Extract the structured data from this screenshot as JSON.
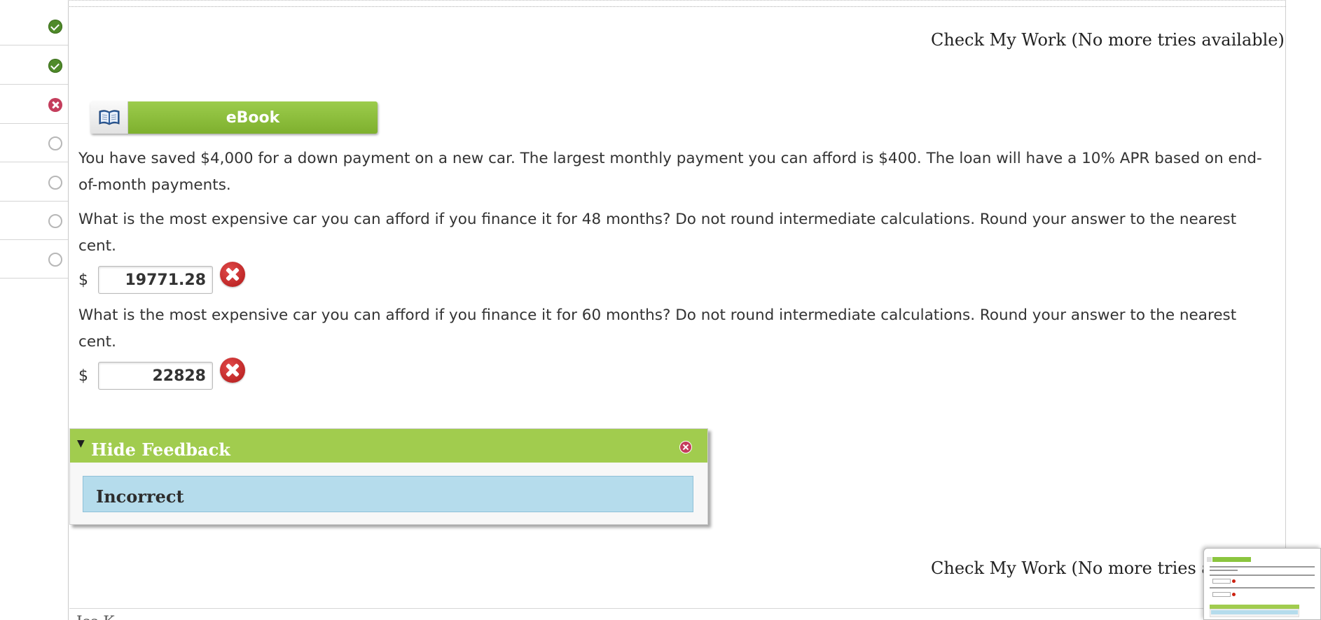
{
  "sidebar": {
    "items": [
      {
        "status": "correct"
      },
      {
        "status": "correct"
      },
      {
        "status": "incorrect"
      },
      {
        "status": "unanswered"
      },
      {
        "status": "unanswered"
      },
      {
        "status": "unanswered"
      },
      {
        "status": "unanswered"
      }
    ]
  },
  "header": {
    "check_work_label": "Check My Work (No more tries available)"
  },
  "ebook": {
    "label": "eBook",
    "icon": "open-book-icon"
  },
  "problem": {
    "intro": "You have saved $4,000 for a down payment on a new car. The largest monthly payment you can afford is $400. The loan will have a 10% APR based on end-of-month payments.",
    "questions": [
      {
        "text": "What is the most expensive car you can afford if you finance it for 48 months? Do not round intermediate calculations. Round your answer to the nearest cent.",
        "currency": "$",
        "answer": "19771.28",
        "result": "incorrect"
      },
      {
        "text": "What is the most expensive car you can afford if you finance it for 60 months? Do not round intermediate calculations. Round your answer to the nearest cent.",
        "currency": "$",
        "answer": "22828",
        "result": "incorrect"
      }
    ]
  },
  "feedback": {
    "toggle_icon": "triangle-down-icon",
    "title": "Hide Feedback",
    "result": "Incorrect",
    "close_icon": "close-icon"
  },
  "footer": {
    "check_work_label": "Check My Work (No more tries available)",
    "partial_text": "Iss K"
  },
  "colors": {
    "accent_green": "#a1cc4e",
    "error_red": "#c43d5c",
    "correct_green": "#4f8a2a",
    "feedback_blue": "#b5dcec"
  }
}
